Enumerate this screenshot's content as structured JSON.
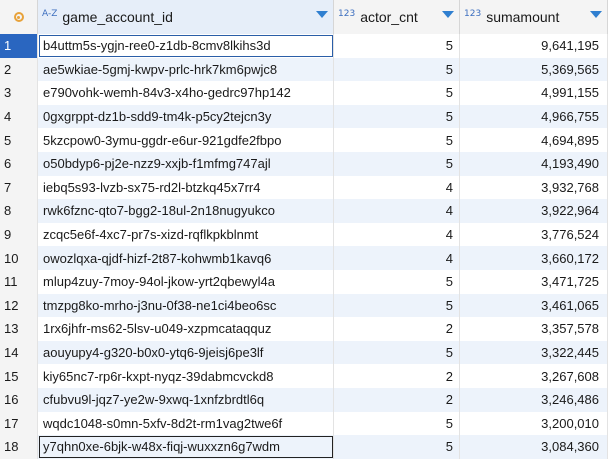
{
  "columns": [
    {
      "type_tag": "A-Z",
      "name": "game_account_id"
    },
    {
      "type_tag": "123",
      "name": "actor_cnt"
    },
    {
      "type_tag": "123",
      "name": "sumamount"
    }
  ],
  "rows": [
    {
      "n": "1",
      "id": "b4uttm5s-ygjn-ree0-z1db-8cmv8lkihs3d",
      "cnt": "5",
      "amt": "9,641,195"
    },
    {
      "n": "2",
      "id": "ae5wkiae-5gmj-kwpv-prlc-hrk7km6pwjc8",
      "cnt": "5",
      "amt": "5,369,565"
    },
    {
      "n": "3",
      "id": "e790vohk-wemh-84v3-x4ho-gedrc97hp142",
      "cnt": "5",
      "amt": "4,991,155"
    },
    {
      "n": "4",
      "id": "0gxgrppt-dz1b-sdd9-tm4k-p5cy2tejcn3y",
      "cnt": "5",
      "amt": "4,966,755"
    },
    {
      "n": "5",
      "id": "5kzcpow0-3ymu-ggdr-e6ur-921gdfe2fbpo",
      "cnt": "5",
      "amt": "4,694,895"
    },
    {
      "n": "6",
      "id": "o50bdyp6-pj2e-nzz9-xxjb-f1mfmg747ajl",
      "cnt": "5",
      "amt": "4,193,490"
    },
    {
      "n": "7",
      "id": "iebq5s93-lvzb-sx75-rd2l-btzkq45x7rr4",
      "cnt": "4",
      "amt": "3,932,768"
    },
    {
      "n": "8",
      "id": "rwk6fznc-qto7-bgg2-18ul-2n18nugyukco",
      "cnt": "4",
      "amt": "3,922,964"
    },
    {
      "n": "9",
      "id": "zcqc5e6f-4xc7-pr7s-xizd-rqflkpkblnmt",
      "cnt": "4",
      "amt": "3,776,524"
    },
    {
      "n": "10",
      "id": "owozlqxa-qjdf-hizf-2t87-kohwmb1kavq6",
      "cnt": "4",
      "amt": "3,660,172"
    },
    {
      "n": "11",
      "id": "mlup4zuy-7moy-94ol-jkow-yrt2qbewyl4a",
      "cnt": "5",
      "amt": "3,471,725"
    },
    {
      "n": "12",
      "id": "tmzpg8ko-mrho-j3nu-0f38-ne1ci4beo6sc",
      "cnt": "5",
      "amt": "3,461,065"
    },
    {
      "n": "13",
      "id": "1rx6jhfr-ms62-5lsv-u049-xzpmcataqquz",
      "cnt": "2",
      "amt": "3,357,578"
    },
    {
      "n": "14",
      "id": "aouyupy4-g320-b0x0-ytq6-9jeisj6pe3lf",
      "cnt": "5",
      "amt": "3,322,445"
    },
    {
      "n": "15",
      "id": "kiy65nc7-rp6r-kxpt-nyqz-39dabmcvckd8",
      "cnt": "2",
      "amt": "3,267,608"
    },
    {
      "n": "16",
      "id": "cfubvu9l-jqz7-ye2w-9xwq-1xnfzbrdtl6q",
      "cnt": "2",
      "amt": "3,246,486"
    },
    {
      "n": "17",
      "id": "wqdc1048-s0mn-5xfv-8d2t-rm1vag2twe6f",
      "cnt": "5",
      "amt": "3,200,010"
    },
    {
      "n": "18",
      "id": "y7qhn0xe-6bjk-w48x-fiqj-wuxxzn6g7wdm",
      "cnt": "5",
      "amt": "3,084,360"
    }
  ],
  "colors": {
    "selected_row_number_bg": "#2a66c0",
    "header_bg": "#f4f4f4",
    "stripe_bg": "#edf3fb",
    "type_tag": "#3d6fbf",
    "sort_arrow": "#2f7fd0",
    "corner_icon": "#e8a23a"
  }
}
